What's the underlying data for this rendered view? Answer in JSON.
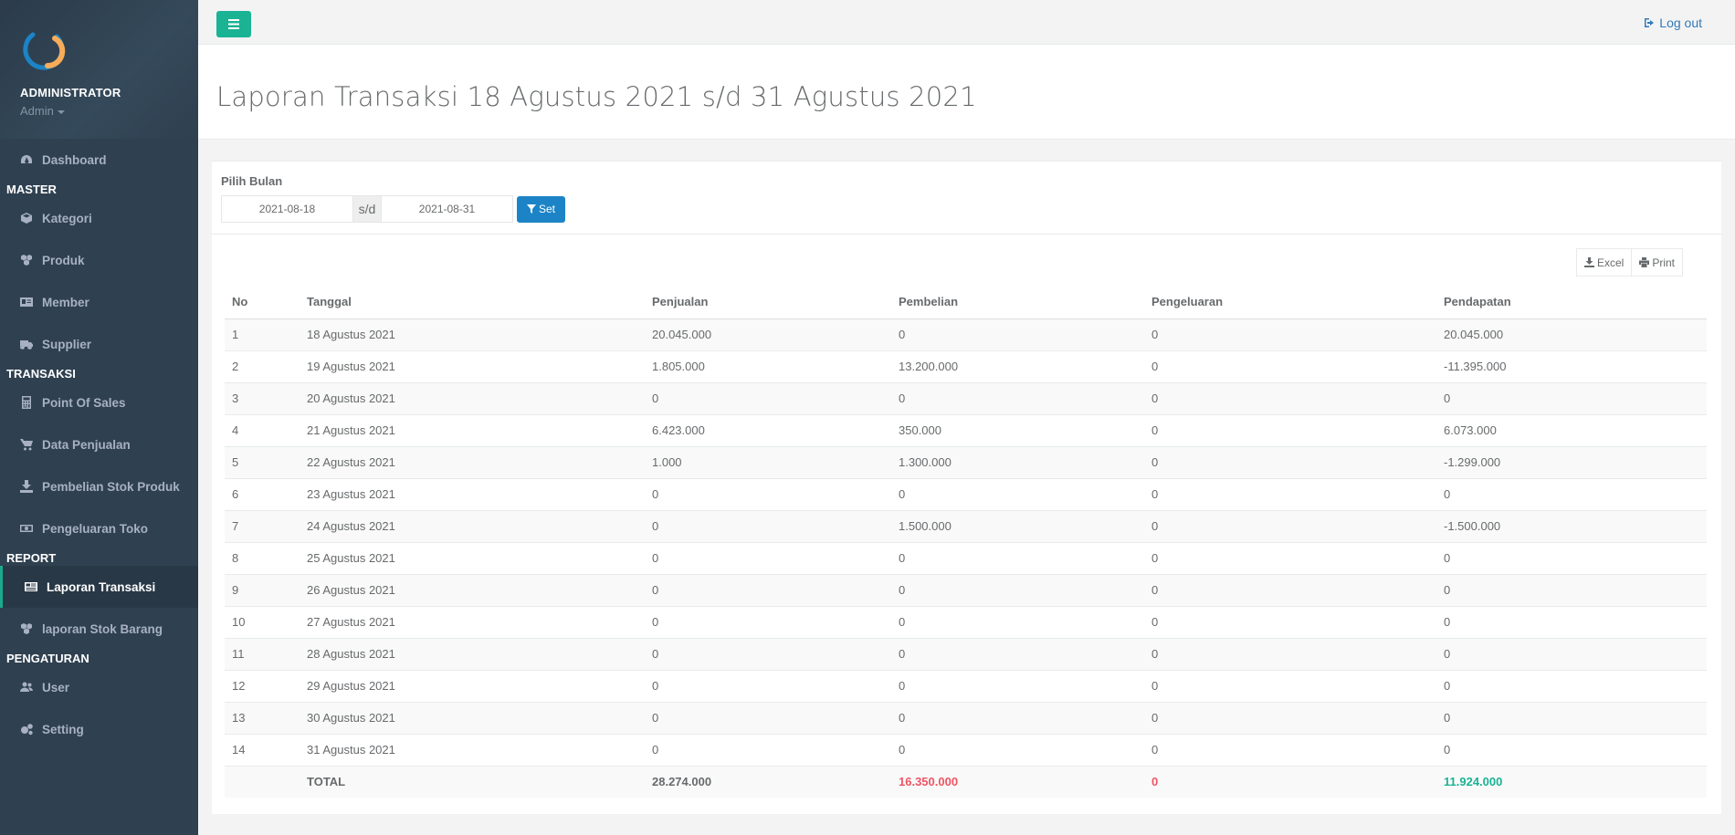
{
  "sidebar": {
    "user_name": "ADMINISTRATOR",
    "role": "Admin",
    "items": [
      {
        "type": "item",
        "label": "Dashboard",
        "icon": "dashboard-icon"
      },
      {
        "type": "section",
        "label": "MASTER"
      },
      {
        "type": "item",
        "label": "Kategori",
        "icon": "cube-icon"
      },
      {
        "type": "item",
        "label": "Produk",
        "icon": "cubes-icon"
      },
      {
        "type": "item",
        "label": "Member",
        "icon": "id-card-icon"
      },
      {
        "type": "item",
        "label": "Supplier",
        "icon": "truck-icon"
      },
      {
        "type": "section",
        "label": "TRANSAKSI"
      },
      {
        "type": "item",
        "label": "Point Of Sales",
        "icon": "calculator-icon"
      },
      {
        "type": "item",
        "label": "Data Penjualan",
        "icon": "cart-icon"
      },
      {
        "type": "item",
        "label": "Pembelian Stok Produk",
        "icon": "download-icon"
      },
      {
        "type": "item",
        "label": "Pengeluaran Toko",
        "icon": "money-icon"
      },
      {
        "type": "section",
        "label": "REPORT"
      },
      {
        "type": "item",
        "label": "Laporan Transaksi",
        "icon": "newspaper-icon",
        "active": true
      },
      {
        "type": "item",
        "label": "laporan Stok Barang",
        "icon": "cubes-icon"
      },
      {
        "type": "section",
        "label": "PENGATURAN"
      },
      {
        "type": "item",
        "label": "User",
        "icon": "users-icon"
      },
      {
        "type": "item",
        "label": "Setting",
        "icon": "cogs-icon"
      }
    ]
  },
  "topbar": {
    "logout_label": "Log out"
  },
  "page": {
    "title": "Laporan Transaksi 18 Agustus 2021 s/d 31 Agustus 2021"
  },
  "filter": {
    "label": "Pilih Bulan",
    "start_date": "2021-08-18",
    "separator": "s/d",
    "end_date": "2021-08-31",
    "set_label": "Set"
  },
  "tools": {
    "excel_label": "Excel",
    "print_label": "Print"
  },
  "table": {
    "columns": [
      "No",
      "Tanggal",
      "Penjualan",
      "Pembelian",
      "Pengeluaran",
      "Pendapatan"
    ],
    "rows": [
      [
        "1",
        "18 Agustus 2021",
        "20.045.000",
        "0",
        "0",
        "20.045.000"
      ],
      [
        "2",
        "19 Agustus 2021",
        "1.805.000",
        "13.200.000",
        "0",
        "-11.395.000"
      ],
      [
        "3",
        "20 Agustus 2021",
        "0",
        "0",
        "0",
        "0"
      ],
      [
        "4",
        "21 Agustus 2021",
        "6.423.000",
        "350.000",
        "0",
        "6.073.000"
      ],
      [
        "5",
        "22 Agustus 2021",
        "1.000",
        "1.300.000",
        "0",
        "-1.299.000"
      ],
      [
        "6",
        "23 Agustus 2021",
        "0",
        "0",
        "0",
        "0"
      ],
      [
        "7",
        "24 Agustus 2021",
        "0",
        "1.500.000",
        "0",
        "-1.500.000"
      ],
      [
        "8",
        "25 Agustus 2021",
        "0",
        "0",
        "0",
        "0"
      ],
      [
        "9",
        "26 Agustus 2021",
        "0",
        "0",
        "0",
        "0"
      ],
      [
        "10",
        "27 Agustus 2021",
        "0",
        "0",
        "0",
        "0"
      ],
      [
        "11",
        "28 Agustus 2021",
        "0",
        "0",
        "0",
        "0"
      ],
      [
        "12",
        "29 Agustus 2021",
        "0",
        "0",
        "0",
        "0"
      ],
      [
        "13",
        "30 Agustus 2021",
        "0",
        "0",
        "0",
        "0"
      ],
      [
        "14",
        "31 Agustus 2021",
        "0",
        "0",
        "0",
        "0"
      ]
    ],
    "total": {
      "label": "TOTAL",
      "penjualan": "28.274.000",
      "pembelian": "16.350.000",
      "pengeluaran": "0",
      "pendapatan": "11.924.000"
    }
  },
  "colors": {
    "sidebar_bg": "#2f4050",
    "accent_green": "#1ab394",
    "primary_blue": "#1c84c6",
    "negative_red": "#ed5565"
  }
}
